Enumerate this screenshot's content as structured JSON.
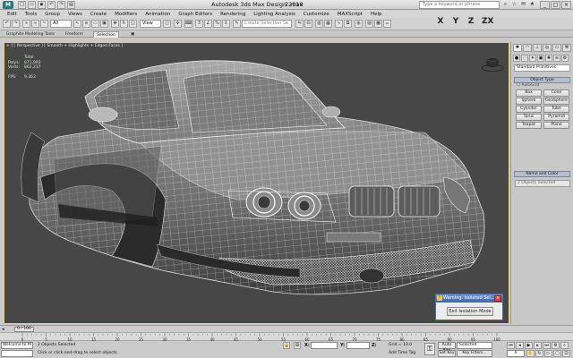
{
  "titlebar": {
    "app_icon": "3ds-max-logo",
    "title": "Autodesk 3ds Max Design 2010",
    "filename": "2.max",
    "search_placeholder": "Type a keyword or phrase",
    "window_controls": [
      "_",
      "□",
      "×"
    ]
  },
  "menu": [
    "Edit",
    "Tools",
    "Group",
    "Views",
    "Create",
    "Modifiers",
    "Animation",
    "Graph Editors",
    "Rendering",
    "Lighting Analysis",
    "Customize",
    "MAXScript",
    "Help"
  ],
  "toolbar": {
    "selection_filter": "All",
    "reference_coord": "View",
    "named_selection": "Create Selection Se",
    "axis_buttons": [
      "X",
      "Y",
      "Z",
      "ZX"
    ]
  },
  "ribbon": {
    "tabs": [
      "Graphite Modeling Tools",
      "Freeform",
      "Selection"
    ],
    "active_tab": "Selection"
  },
  "viewport": {
    "label": "+ ] [ Perspective ] [ Smooth + Highlights + Edged Faces ]",
    "stats": {
      "header": "Total",
      "polys_label": "Polys:",
      "polys": "871,992",
      "verts_label": "Verts:",
      "verts": "862,237",
      "fps_label": "FPS:",
      "fps": "9.363"
    }
  },
  "warning_dialog": {
    "title": "Warning: Isolated Sel...",
    "button": "Exit Isolation Mode"
  },
  "command_panel": {
    "dropdown": "Standard Primitives",
    "object_type_header": "Object Type",
    "autogrid": "AutoGrid",
    "objects": [
      "Box",
      "Cone",
      "Sphere",
      "GeoSphere",
      "Cylinder",
      "Tube",
      "Torus",
      "Pyramid",
      "Teapot",
      "Plane"
    ],
    "name_color_header": "Name and Color",
    "name_field": "2 Objects Selected"
  },
  "timeline": {
    "position": "0 / 100",
    "ticks": [
      "0",
      "5",
      "10",
      "15",
      "20",
      "25",
      "30",
      "35",
      "40",
      "45",
      "50",
      "55",
      "60",
      "65",
      "70",
      "75",
      "80",
      "85",
      "90",
      "95",
      "100"
    ]
  },
  "status": {
    "script_text": "Welcome to M",
    "selected": "2 Objects Selected",
    "prompt": "Click or click-and-drag to select objects",
    "x_label": "X:",
    "y_label": "Y:",
    "z_label": "Z:",
    "grid": "Grid = 10.0",
    "add_time_tag": "Add Time Tag",
    "auto_key": "Auto Key",
    "set_key": "Set Key",
    "key_mode": "Selected",
    "key_filters": "Key Filters...",
    "frame": "0"
  }
}
